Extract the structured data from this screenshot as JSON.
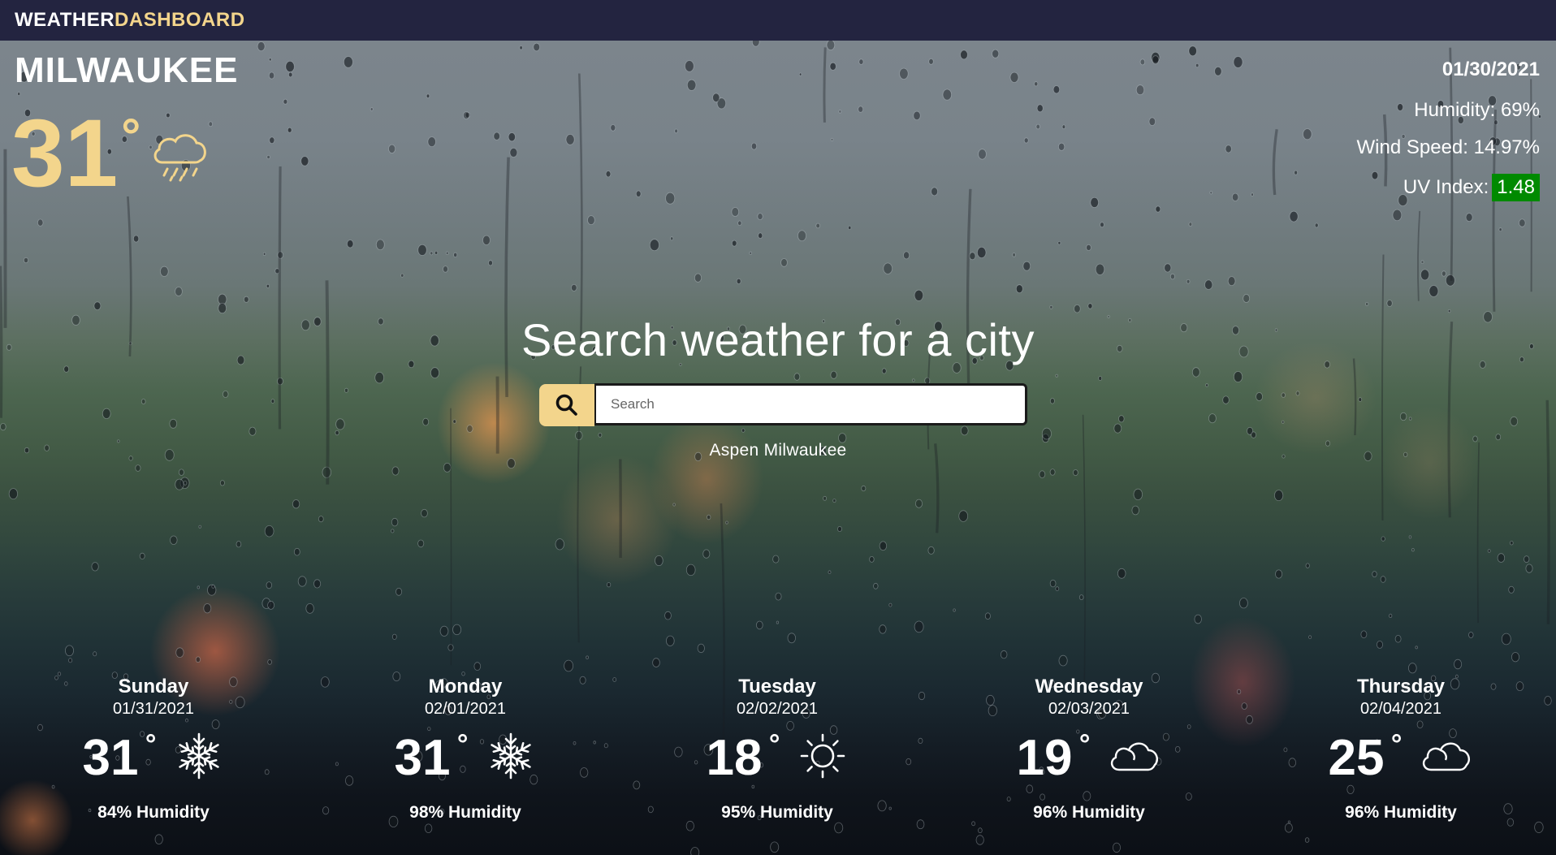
{
  "header": {
    "brand_part1": "WEATHER",
    "brand_part2": "DASHBOARD"
  },
  "current": {
    "city": "MILWAUKEE",
    "temp": "31",
    "degree_symbol": "°",
    "icon": "cloud-rain-icon",
    "date": "01/30/2021",
    "humidity": "Humidity: 69%",
    "wind": "Wind Speed: 14.97%",
    "uv_label": "UV Index:",
    "uv_value": "1.48",
    "uv_color": "#008a00"
  },
  "search": {
    "title": "Search weather for a city",
    "placeholder": "Search",
    "history": [
      "Aspen",
      "Milwaukee"
    ]
  },
  "forecast": [
    {
      "day": "Sunday",
      "date": "01/31/2021",
      "temp": "31",
      "icon": "snowflake-icon",
      "humidity": "84% Humidity"
    },
    {
      "day": "Monday",
      "date": "02/01/2021",
      "temp": "31",
      "icon": "snowflake-icon",
      "humidity": "98% Humidity"
    },
    {
      "day": "Tuesday",
      "date": "02/02/2021",
      "temp": "18",
      "icon": "sun-icon",
      "humidity": "95% Humidity"
    },
    {
      "day": "Wednesday",
      "date": "02/03/2021",
      "temp": "19",
      "icon": "cloud-icon",
      "humidity": "96% Humidity"
    },
    {
      "day": "Thursday",
      "date": "02/04/2021",
      "temp": "25",
      "icon": "cloud-icon",
      "humidity": "96% Humidity"
    }
  ],
  "colors": {
    "accent": "#f3d58c",
    "navbar": "#232440",
    "uv_badge": "#008a00"
  }
}
